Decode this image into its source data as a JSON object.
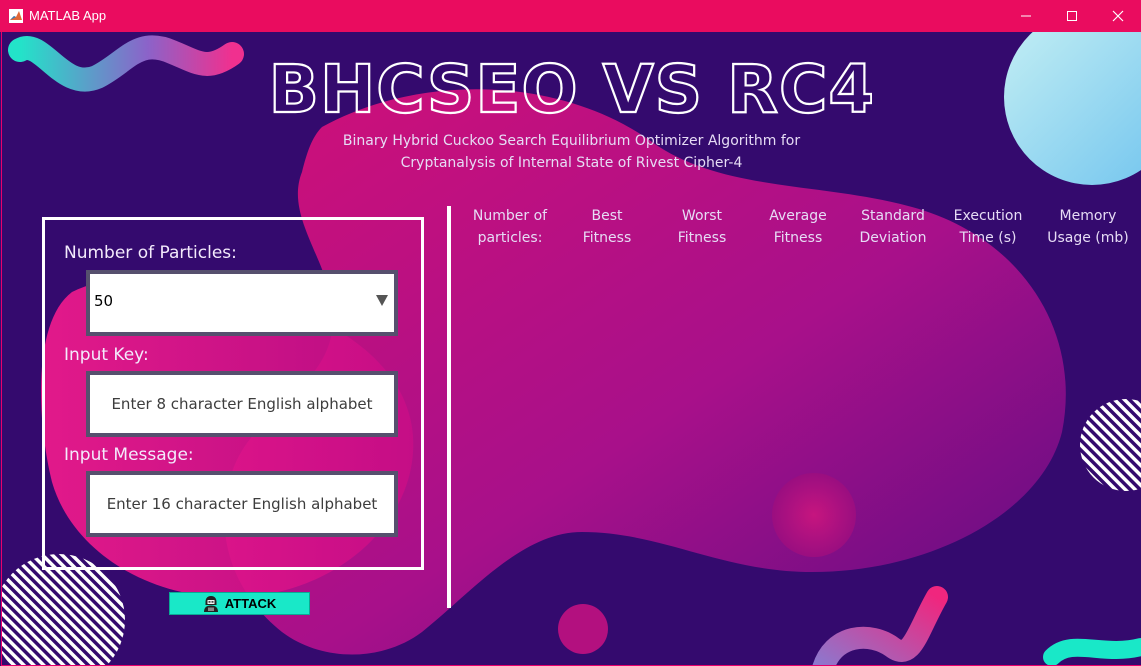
{
  "window": {
    "title": "MATLAB App",
    "icons": [
      "matlab-logo-icon",
      "minimize-icon",
      "maximize-icon",
      "close-icon"
    ]
  },
  "header": {
    "title": "BHCSEO VS RC4",
    "subtitle_line1": "Binary Hybrid Cuckoo Search Equilibrium Optimizer Algorithm for",
    "subtitle_line2": "Cryptanalysis of Internal State of Rivest Cipher-4"
  },
  "form": {
    "particles_label": "Number of Particles:",
    "particles_value": "50",
    "key_label": "Input Key:",
    "key_placeholder": "Enter 8 character English alphabet",
    "message_label": "Input Message:",
    "message_placeholder": "Enter 16 character English alphabet"
  },
  "attack_button": {
    "label": "ATTACK",
    "icon": "hacker-icon"
  },
  "results_table": {
    "columns": [
      [
        "Number of",
        "particles:"
      ],
      [
        "Best",
        "Fitness"
      ],
      [
        "Worst",
        "Fitness"
      ],
      [
        "Average",
        "Fitness"
      ],
      [
        "Standard",
        "Deviation"
      ],
      [
        "Execution",
        "Time (s)"
      ],
      [
        "Memory",
        "Usage (mb)"
      ]
    ]
  },
  "colors": {
    "titlebar": "#ea0c5f",
    "background": "#340a6e",
    "accent_teal": "#19e8c8",
    "blob_magenta": "#c0107f"
  }
}
